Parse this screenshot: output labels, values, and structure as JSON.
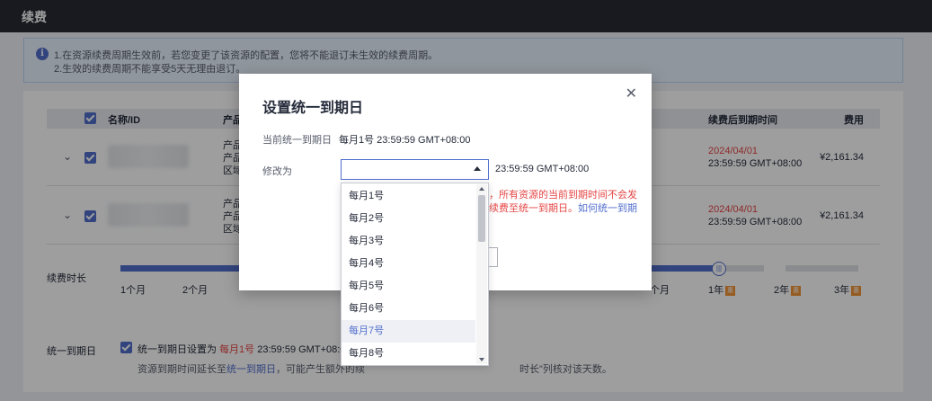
{
  "header": {
    "title": "续费"
  },
  "notice": {
    "icon": "info-icon",
    "line1": "1.在资源续费周期生效前，若您变更了该资源的配置，您将不能退订未生效的续费周期。",
    "line2": "2.生效的续费周期不能享受5天无理由退订。"
  },
  "table": {
    "columns": {
      "name": "名称/ID",
      "product": "产品",
      "expire_after": "续费后到期时间",
      "fee": "费用"
    },
    "rows": [
      {
        "product_lines": [
          "产品",
          "产品",
          "区域"
        ],
        "expire_date": "2024/04/01",
        "expire_time": "23:59:59 GMT+08:00",
        "fee": "¥2,161.34"
      },
      {
        "product_lines": [
          "产品",
          "产品",
          "区域"
        ],
        "expire_date": "2024/04/01",
        "expire_time": "23:59:59 GMT+08:00",
        "fee": "¥2,161.34"
      }
    ]
  },
  "duration": {
    "label": "续费时长",
    "ticks": [
      "1个月",
      "2个月",
      "个月",
      "1年",
      "2年",
      "3年"
    ],
    "tag": "惠",
    "handle_icon": "drag-handle-icon"
  },
  "unify": {
    "label": "统一到期日",
    "checked": true,
    "text_prefix": "统一到期日设置为",
    "date": "每月1号",
    "time": "23:59:59 GMT+08:00",
    "hint_prefix": "资源到期时间延长至",
    "hint_link": "统一到期日",
    "hint_mid": "，可能产生额外的续",
    "hint_suffix": "时长\"列核对该天数。"
  },
  "dialog": {
    "title": "设置统一到期日",
    "close_icon": "close-icon",
    "current_label": "当前统一到期日",
    "current_value": "每月1号  23:59:59 GMT+08:00",
    "change_label": "修改为",
    "select_value": "",
    "select_suffix": "23:59:59 GMT+08:00",
    "warn_line1": "，所有资源的当前到期时间不会发",
    "warn_line2_red": "续费至统一到期日。",
    "warn_line2_link": "如何统一到期"
  },
  "dropdown": {
    "options": [
      "每月1号",
      "每月2号",
      "每月3号",
      "每月4号",
      "每月5号",
      "每月6号",
      "每月7号",
      "每月8号"
    ],
    "highlighted": "每月7号"
  },
  "colors": {
    "accent": "#526ecc",
    "danger": "#e54545",
    "topbar": "#282b33",
    "tag": "#f09434"
  }
}
